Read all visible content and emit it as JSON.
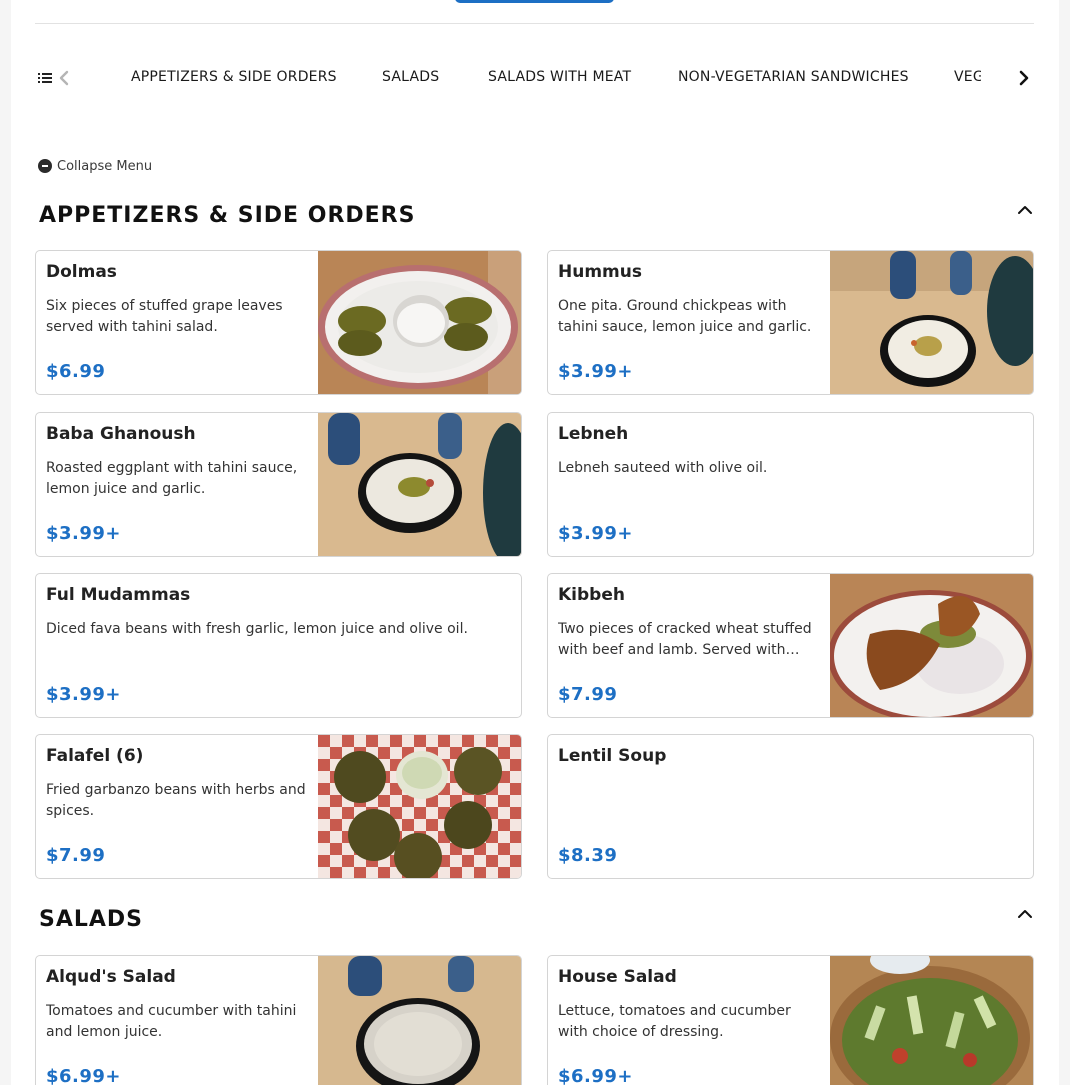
{
  "category_nav": {
    "items": [
      "APPETIZERS & SIDE ORDERS",
      "SALADS",
      "SALADS WITH MEAT",
      "NON-VEGETARIAN SANDWICHES",
      "VEGE"
    ],
    "list_icon": "list-icon",
    "prev_icon": "chevron-left-icon",
    "next_icon": "chevron-right-icon"
  },
  "collapse_menu": {
    "label": "Collapse Menu",
    "icon": "minus-circle-icon"
  },
  "colors": {
    "accent": "#1d6fc4",
    "text": "#1a1a1a",
    "border": "#d4d4d4"
  },
  "sections": [
    {
      "title": "APPETIZERS & SIDE ORDERS",
      "toggle_icon": "chevron-up-icon",
      "items": [
        {
          "name": "Dolmas",
          "description": "Six pieces of stuffed grape leaves served with tahini salad.",
          "price": "$6.99",
          "image": "dolmas-photo"
        },
        {
          "name": "Hummus",
          "description": "One pita. Ground chickpeas with tahini sauce, lemon juice and garlic.",
          "price": "$3.99+",
          "image": "hummus-photo"
        },
        {
          "name": "Baba Ghanoush",
          "description": "Roasted eggplant with tahini sauce, lemon juice and garlic.",
          "price": "$3.99+",
          "image": "baba-ghanoush-photo"
        },
        {
          "name": "Lebneh",
          "description": "Lebneh sauteed with olive oil.",
          "price": "$3.99+"
        },
        {
          "name": "Ful Mudammas",
          "description": "Diced fava beans with fresh garlic, lemon juice and olive oil.",
          "price": "$3.99+"
        },
        {
          "name": "Kibbeh",
          "description": "Two pieces of cracked wheat stuffed with beef and lamb. Served with…",
          "price": "$7.99",
          "image": "kibbeh-photo"
        },
        {
          "name": "Falafel (6)",
          "description": "Fried garbanzo beans with herbs and spices.",
          "price": "$7.99",
          "image": "falafel-photo"
        },
        {
          "name": "Lentil Soup",
          "description": "",
          "price": "$8.39"
        }
      ]
    },
    {
      "title": "SALADS",
      "toggle_icon": "chevron-up-icon",
      "items": [
        {
          "name": "Alqud's Salad",
          "description": "Tomatoes and cucumber with tahini and lemon juice.",
          "price": "$6.99+",
          "image": "alquds-salad-photo"
        },
        {
          "name": "House Salad",
          "description": "Lettuce, tomatoes and cucumber with choice of dressing.",
          "price": "$6.99+",
          "image": "house-salad-photo"
        }
      ]
    }
  ]
}
